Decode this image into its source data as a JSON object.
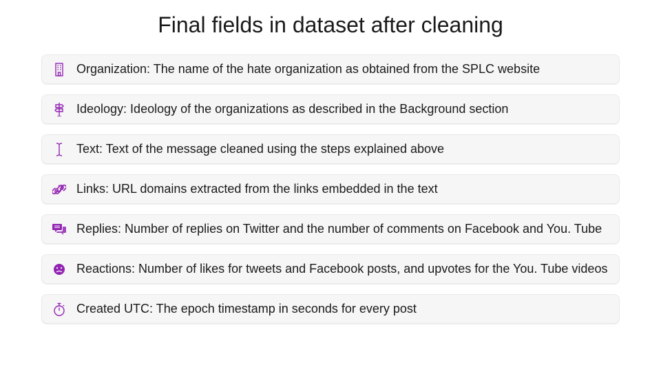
{
  "title": "Final fields in dataset after cleaning",
  "icon_color": "#9324b3",
  "fields": [
    {
      "icon": "building",
      "text": "Organization: The name of the hate organization as obtained from the SPLC website"
    },
    {
      "icon": "signpost",
      "text": "Ideology: Ideology of the organizations as described in the Background section"
    },
    {
      "icon": "cursor",
      "text": "Text: Text of the message cleaned using the steps explained above"
    },
    {
      "icon": "link",
      "text": "Links: URL domains extracted from the links embedded in the text"
    },
    {
      "icon": "comments",
      "text": "Replies: Number of replies on Twitter and the number of comments on Facebook and You. Tube"
    },
    {
      "icon": "face",
      "text": "Reactions: Number of likes for tweets and Facebook posts, and upvotes for the You. Tube videos"
    },
    {
      "icon": "stopwatch",
      "text": "Created UTC: The epoch timestamp in seconds for every post"
    }
  ]
}
